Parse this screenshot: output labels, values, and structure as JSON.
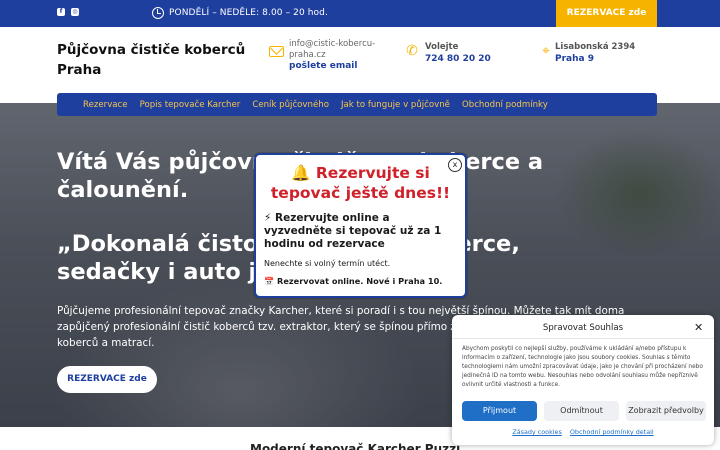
{
  "topbar": {
    "social_icons": [
      "facebook-icon",
      "instagram-icon"
    ],
    "hours": "PONDĚLÍ – NEDĚLE: 8.00 – 20 hod.",
    "cta": "REZERVACE zde"
  },
  "header": {
    "brand": "Půjčovna čističe koberců Praha",
    "email": {
      "value": "info@cistic-kobercu-praha.cz",
      "label": "pošlete email"
    },
    "phone": {
      "label": "Volejte",
      "value": "724 80 20 20"
    },
    "address": {
      "street": "Lisabonská 2394",
      "city": "Praha 9"
    }
  },
  "nav": {
    "items": [
      "Rezervace",
      "Popis tepovače Karcher",
      "Ceník půjčovného",
      "Jak to funguje v půjčovně",
      "Obchodní podmínky"
    ]
  },
  "hero": {
    "title": "Vítá Vás půjčovna čističe na koberce a čalounění.",
    "subtitle": "„Dokonalá čistota pro Vaše koberce, sedačky i auto již od...",
    "text": "Půjčujeme profesionální tepovač značky Karcher, které si poradí i s tou největší špínou. Můžete tak mít doma zapůjčený profesionální čistič koberců tzv. extraktor, který se špínou přímo zatočí. Perfektní řešení pro čištění koberců a matrací.",
    "button": "REZERVACE zde"
  },
  "below": {
    "heading": "Moderní tepovač Karcher Puzzi..."
  },
  "popup": {
    "title": "🔔 Rezervujte si tepovač ještě dnes!!",
    "line1": "⚡ Rezervujte online a vyzvedněte si tepovač už za 1 hodinu od rezervace",
    "line2": "Nenechte si volný termín utéct.",
    "line3": "📅 Rezervovat online. Nové i Praha 10.",
    "close": "x"
  },
  "cookie": {
    "title": "Spravovat Souhlas",
    "close": "✕",
    "description": "Abychom poskytli co nejlepší služby, používáme k ukládání a/nebo přístupu k informacím o zařízení, technologie jako jsou soubory cookies. Souhlas s těmito technologiemi nám umožní zpracovávat údaje, jako je chování při procházení nebo jedinečná ID na tomto webu. Nesouhlas nebo odvolání souhlasu může nepříznivě ovlivnit určité vlastnosti a funkce.",
    "accept": "Přijmout",
    "reject": "Odmítnout",
    "preferences": "Zobrazit předvolby",
    "links": [
      "Zásady cookies",
      "Obchodní podmínky detail"
    ]
  },
  "colors": {
    "primary_blue": "#1f3f9f",
    "accent_yellow": "#f6b400",
    "popup_red": "#d0202a",
    "cookie_blue": "#1f6fc7"
  }
}
